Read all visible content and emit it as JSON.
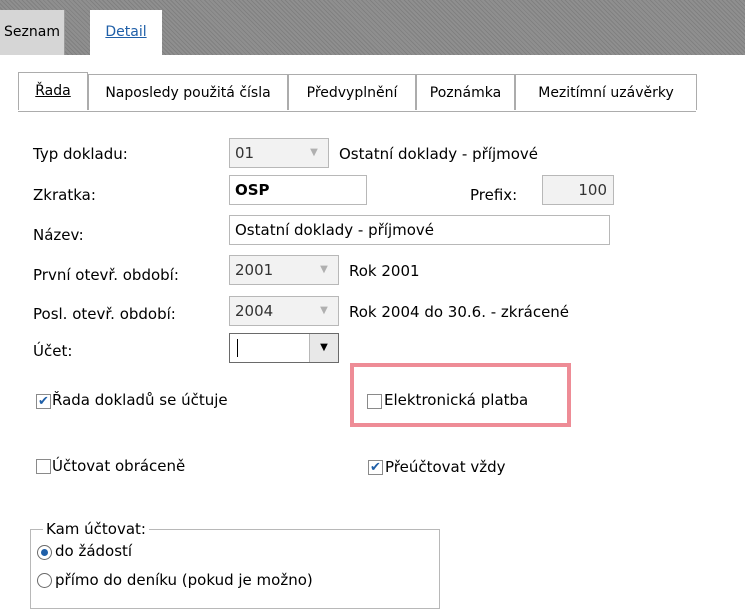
{
  "top_tabs": [
    "Seznam",
    "Detail"
  ],
  "tabs": [
    "Řada",
    "Naposledy použitá čísla",
    "Předvyplnění",
    "Poznámka",
    "Mezitímní uzávěrky"
  ],
  "form": {
    "typ_dokladu": {
      "label": "Typ dokladu:",
      "value": "01",
      "description": "Ostatní doklady - příjmové"
    },
    "zkratka": {
      "label": "Zkratka:",
      "value": "OSP"
    },
    "prefix": {
      "label": "Prefix:",
      "value": "100"
    },
    "nazev": {
      "label": "Název:",
      "value": "Ostatní doklady - příjmové"
    },
    "prvni_obdobi": {
      "label": "První otevř. období:",
      "value": "2001",
      "description": "Rok 2001"
    },
    "posl_obdobi": {
      "label": "Posl. otevř. období:",
      "value": "2004",
      "description": "Rok 2004 do 30.6. - zkrácené"
    },
    "ucet": {
      "label": "Účet:",
      "value": ""
    }
  },
  "checkboxes": {
    "rada_uctuje": {
      "label": "Řada dokladů se účtuje",
      "checked": true
    },
    "elektronicka_platba": {
      "label": "Elektronická platba",
      "checked": false
    },
    "uctovat_obracene": {
      "label": "Účtovat obráceně",
      "checked": false
    },
    "preuctovat_vzdy": {
      "label": "Přeúčtovat vždy",
      "checked": true
    }
  },
  "kam_uctovat": {
    "legend": "Kam účtovat:",
    "options": [
      "do žádostí",
      "přímo do deníku (pokud je možno)"
    ],
    "selected": "do žádostí"
  },
  "colors": {
    "accent": "#1f5fa8",
    "highlight": "#ee8c96"
  }
}
